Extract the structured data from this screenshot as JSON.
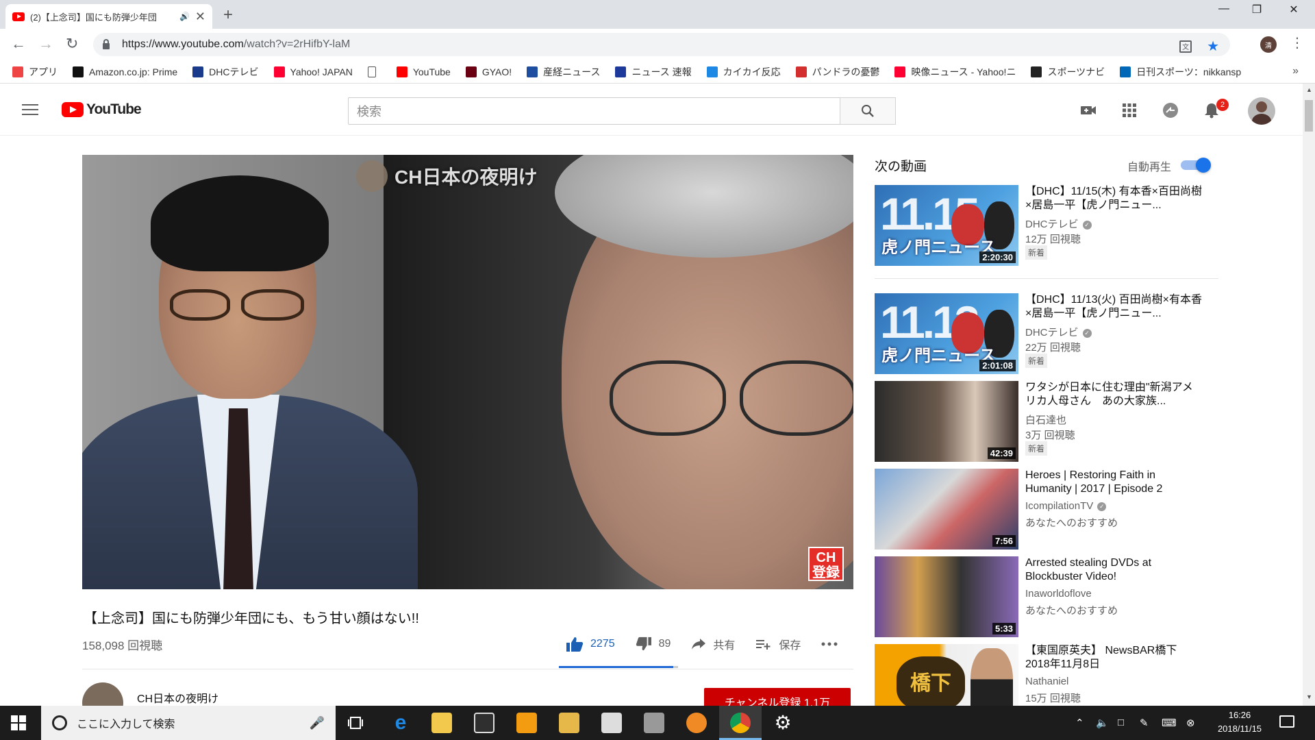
{
  "browser": {
    "tab_title": "(2)【上念司】国にも防弾少年団",
    "url_host": "https://www.youtube.com",
    "url_path": "/watch?v=2rHifbY-laM",
    "profile_initial": "清"
  },
  "bookmarks": [
    {
      "label": "アプリ",
      "icon": "apps-grid-icon",
      "color": "#e44"
    },
    {
      "label": "Amazon.co.jp: Prime",
      "icon": "amazon-icon",
      "color": "#111"
    },
    {
      "label": "DHCテレビ",
      "icon": "dhc-icon",
      "color": "#1a3a8c"
    },
    {
      "label": "Yahoo! JAPAN",
      "icon": "yahoo-icon",
      "color": "#ff0033"
    },
    {
      "label": "",
      "icon": "page-icon",
      "color": "#fff"
    },
    {
      "label": "YouTube",
      "icon": "youtube-icon",
      "color": "#ff0000"
    },
    {
      "label": "GYAO!",
      "icon": "gyao-icon",
      "color": "#6a0012"
    },
    {
      "label": "産経ニュース",
      "icon": "sankei-icon",
      "color": "#1d4ea0"
    },
    {
      "label": "ニュース 速報",
      "icon": "news-icon",
      "color": "#1d3a9a"
    },
    {
      "label": "カイカイ反応",
      "icon": "kaikai-icon",
      "color": "#1e88e5"
    },
    {
      "label": "パンドラの憂鬱",
      "icon": "pandora-icon",
      "color": "#d32f2f"
    },
    {
      "label": "映像ニュース - Yahoo!ニ",
      "icon": "yahoo-news-icon",
      "color": "#ff0033"
    },
    {
      "label": "スポーツナビ",
      "icon": "sportsnavi-icon",
      "color": "#222"
    },
    {
      "label": "日刊スポーツ：nikkansp",
      "icon": "nikkan-icon",
      "color": "#0068b7"
    }
  ],
  "masthead": {
    "logo_text": "YouTube",
    "search_placeholder": "検索",
    "notification_count": "2"
  },
  "video": {
    "title": "【上念司】国にも防弾少年団にも、もう甘い顔はない!!",
    "views": "158,098 回視聴",
    "likes": "2275",
    "dislikes": "89",
    "share_label": "共有",
    "save_label": "保存",
    "like_ratio": 0.96,
    "watermark": "CH日本の夜明け",
    "subscribe_badge": "CH\n登録"
  },
  "channel": {
    "name": "CH日本の夜明け",
    "subscribe_button": "チャンネル登録 1.1万"
  },
  "sidebar": {
    "up_next": "次の動画",
    "autoplay_label": "自動再生",
    "autoplay_on": true,
    "items": [
      {
        "title": "【DHC】11/15(木) 有本香×百田尚樹×居島一平【虎ノ門ニュー...",
        "channel": "DHCテレビ",
        "verified": true,
        "views": "12万 回視聴",
        "badge": "新着",
        "duration": "2:20:30",
        "thumb_text": "11.15",
        "thumb_caption": "虎ノ門ニュース"
      },
      {
        "title": "【DHC】11/13(火) 百田尚樹×有本香×居島一平【虎ノ門ニュー...",
        "channel": "DHCテレビ",
        "verified": true,
        "views": "22万 回視聴",
        "badge": "新着",
        "duration": "2:01:08",
        "thumb_text": "11.13",
        "thumb_caption": "虎ノ門ニュース"
      },
      {
        "title": "ワタシが日本に住む理由\"新潟アメリカ人母さん　あの大家族...",
        "channel": "白石達也",
        "verified": false,
        "views": "3万 回視聴",
        "badge": "新着",
        "duration": "42:39"
      },
      {
        "title": "Heroes | Restoring Faith in Humanity | 2017 | Episode 2",
        "channel": "IcompilationTV",
        "verified": true,
        "views": "あなたへのおすすめ",
        "badge": "",
        "duration": "7:56"
      },
      {
        "title": "Arrested stealing DVDs at Blockbuster Video!",
        "channel": "Inaworldoflove",
        "verified": false,
        "views": "あなたへのおすすめ",
        "badge": "",
        "duration": "5:33"
      },
      {
        "title": "【東国原英夫】 NewsBAR橋下 2018年11月8日",
        "channel": "Nathaniel",
        "verified": false,
        "views": "15万 回視聴",
        "badge": "",
        "duration": "",
        "thumb_text": "橋下"
      }
    ]
  },
  "taskbar": {
    "search_placeholder": "ここに入力して検索",
    "time": "16:26",
    "date": "2018/11/15"
  }
}
